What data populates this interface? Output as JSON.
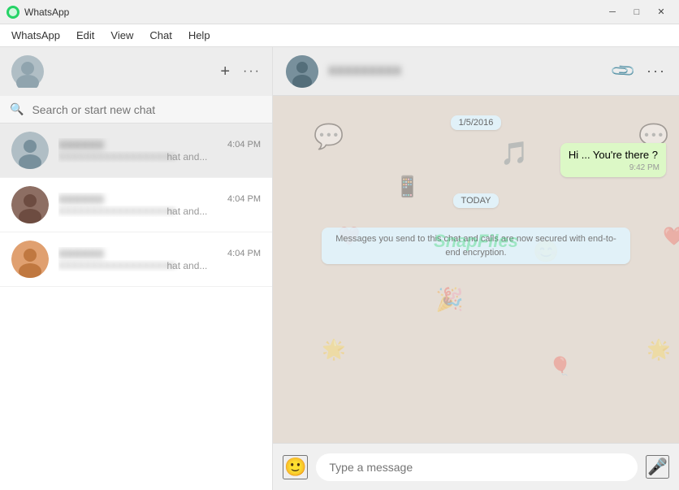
{
  "titlebar": {
    "title": "WhatsApp",
    "min_btn": "─",
    "max_btn": "□",
    "close_btn": "✕"
  },
  "menubar": {
    "items": [
      "WhatsApp",
      "Edit",
      "View",
      "Chat",
      "Help"
    ]
  },
  "left_header": {
    "new_chat_icon": "+",
    "more_icon": "···"
  },
  "search": {
    "placeholder": "Search or start new chat"
  },
  "chats": [
    {
      "name": "Contact 1",
      "time": "4:04 PM",
      "preview": "hat and..."
    },
    {
      "name": "Contact 2",
      "time": "4:04 PM",
      "preview": "hat and..."
    },
    {
      "name": "Contact 3",
      "time": "4:04 PM",
      "preview": "hat and..."
    }
  ],
  "active_chat": {
    "name": "Active Contact",
    "attach_label": "Attach",
    "more_label": "More"
  },
  "messages": [
    {
      "type": "date",
      "text": "1/5/2016"
    },
    {
      "type": "sent",
      "text": "Hi ... You're there ?",
      "time": "9:42 PM"
    },
    {
      "type": "date",
      "text": "TODAY"
    },
    {
      "type": "system",
      "text": "Messages you send to this chat and calls are now secured with end-to-end encryption."
    }
  ],
  "input": {
    "placeholder": "Type a message"
  },
  "watermark": "SnapFiles"
}
